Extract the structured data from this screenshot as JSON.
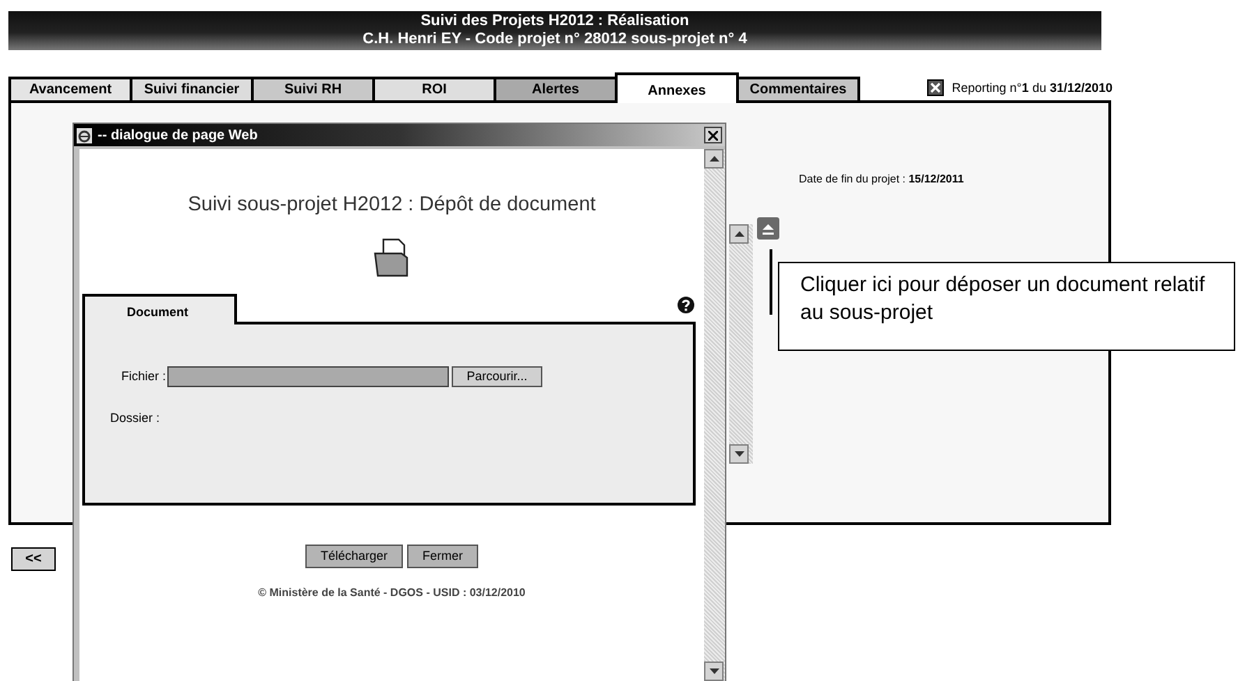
{
  "header": {
    "title": "Suivi des Projets H2012 : Réalisation",
    "subtitle": "C.H. Henri EY - Code projet n° 28012 sous-projet n° 4"
  },
  "tabs": [
    {
      "label": "Avancement",
      "selected": false,
      "color": "#e4e4e4"
    },
    {
      "label": "Suivi financier",
      "selected": false,
      "color": "#dcdcdc"
    },
    {
      "label": "Suivi RH",
      "selected": false,
      "color": "#c8c8c8"
    },
    {
      "label": "ROI",
      "selected": false,
      "color": "#dedede"
    },
    {
      "label": "Alertes",
      "selected": false,
      "color": "#a9a9a9"
    },
    {
      "label": "Annexes",
      "selected": true,
      "color": "#ffffff"
    },
    {
      "label": "Commentaires",
      "selected": false,
      "color": "#c4c4c4"
    }
  ],
  "reporting": "Reporting n°**1** du **31/12/2010**",
  "project_end": {
    "label": "Date de fin du projet :",
    "value": "15/12/2011"
  },
  "back_button": "<<",
  "callout": "Cliquer ici pour déposer un document relatif au sous-projet",
  "dialog": {
    "title": "-- dialogue de page Web",
    "heading": "Suivi sous-projet H2012 : Dépôt de document",
    "tab": "Document",
    "fields": [
      {
        "kind": "file",
        "label": "Fichier :",
        "button": "Parcourir..."
      },
      {
        "kind": "text",
        "label": "Dossier :"
      }
    ],
    "buttons": [
      "Télécharger",
      "Fermer"
    ],
    "footer": "© Ministère de la Santé - DGOS - USID : 03/12/2010"
  }
}
